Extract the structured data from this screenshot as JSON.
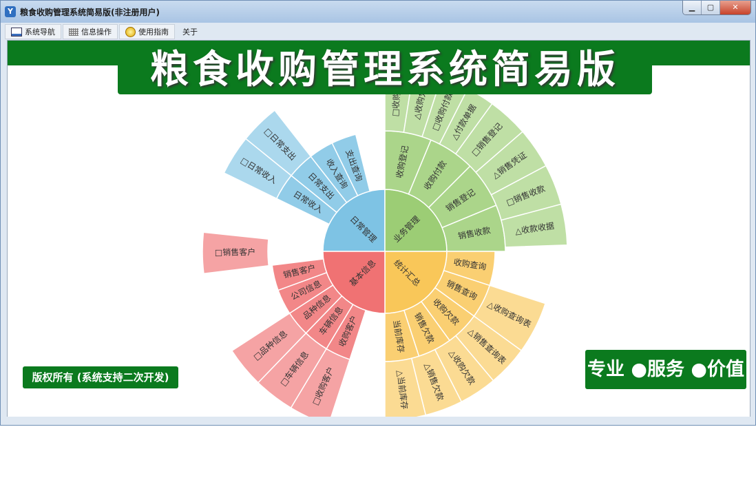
{
  "window": {
    "title": "粮食收购管理系统简易版(非注册用户)",
    "app_icon": "app-logo-icon"
  },
  "window_buttons": {
    "minimize": "▁",
    "maximize": "▢",
    "close": "✕"
  },
  "menu": [
    {
      "label": "系统导航",
      "icon": "navigation-icon"
    },
    {
      "label": "信息操作",
      "icon": "grid-icon"
    },
    {
      "label": "使用指南",
      "icon": "help-icon"
    },
    {
      "label": "关于",
      "icon": ""
    }
  ],
  "banner": {
    "title": "粮食收购管理系统简易版"
  },
  "footer": {
    "copyright": "版权所有 (系统支持二次开发)",
    "slogan": "专业 ●服务 ●价值"
  },
  "colors": {
    "green": "#0b7a1e",
    "blue": "#7ec3e4",
    "lightgreen": "#9ccd75",
    "yellow": "#f9c759",
    "red": "#f07273"
  },
  "sunburst": {
    "inner": [
      {
        "label": "日常管理",
        "color": "#7ec3e4"
      },
      {
        "label": "业务管理",
        "color": "#9ccd75"
      },
      {
        "label": "统计汇总",
        "color": "#f9c759"
      },
      {
        "label": "基本信息",
        "color": "#f07273"
      }
    ],
    "middle": [
      {
        "label": "日常收入",
        "parent": "日常管理"
      },
      {
        "label": "日常支出",
        "parent": "日常管理"
      },
      {
        "label": "收入查询",
        "parent": "日常管理"
      },
      {
        "label": "支出查询",
        "parent": "日常管理"
      },
      {
        "label": "收购登记",
        "parent": "业务管理"
      },
      {
        "label": "收购付款",
        "parent": "业务管理"
      },
      {
        "label": "销售登记",
        "parent": "业务管理"
      },
      {
        "label": "销售收款",
        "parent": "业务管理"
      },
      {
        "label": "收购查询",
        "parent": "统计汇总"
      },
      {
        "label": "销售查询",
        "parent": "统计汇总"
      },
      {
        "label": "收购欠款",
        "parent": "统计汇总"
      },
      {
        "label": "销售欠款",
        "parent": "统计汇总"
      },
      {
        "label": "当前库存",
        "parent": "统计汇总"
      },
      {
        "label": "收购客户",
        "parent": "基本信息"
      },
      {
        "label": "车辆信息",
        "parent": "基本信息"
      },
      {
        "label": "品种信息",
        "parent": "基本信息"
      },
      {
        "label": "公司信息",
        "parent": "基本信息"
      },
      {
        "label": "销售客户",
        "parent": "基本信息"
      }
    ],
    "outer": [
      {
        "label": "□日常收入"
      },
      {
        "label": "□日常支出"
      },
      {
        "label": "□收购登"
      },
      {
        "label": "△收购凭"
      },
      {
        "label": "□收购付款"
      },
      {
        "label": "△付款单据"
      },
      {
        "label": "□销售登记"
      },
      {
        "label": "△销售凭证"
      },
      {
        "label": "□销售收款"
      },
      {
        "label": "△收款收据"
      },
      {
        "label": "△收购查询表"
      },
      {
        "label": "△销售查询表"
      },
      {
        "label": "△收购欠款"
      },
      {
        "label": "△销售欠款"
      },
      {
        "label": "△当前库存"
      },
      {
        "label": "□收购客户"
      },
      {
        "label": "□车辆信息"
      },
      {
        "label": "□品种信息"
      },
      {
        "label": "□销售客户"
      }
    ]
  }
}
